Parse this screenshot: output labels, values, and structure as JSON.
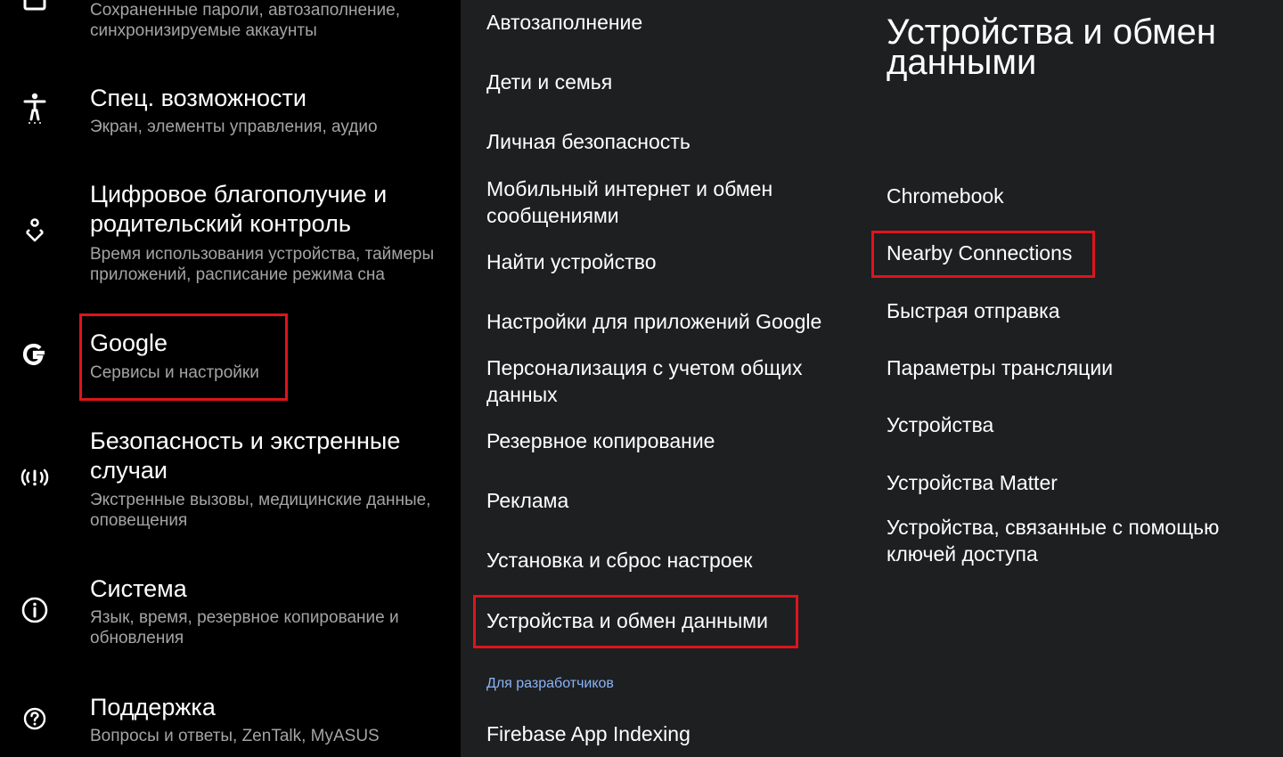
{
  "left_panel": {
    "items": [
      {
        "id": "passwords",
        "title": "",
        "subtitle": "Сохраненные пароли, автозаполнение, синхронизируемые аккаунты",
        "icon": "account-box-icon"
      },
      {
        "id": "accessibility",
        "title": "Спец. возможности",
        "subtitle": "Экран, элементы управления, аудио",
        "icon": "accessibility-icon"
      },
      {
        "id": "digital_wellbeing",
        "title": "Цифровое благополучие и родительский контроль",
        "subtitle": "Время использования устройства, таймеры приложений, расписание режима сна",
        "icon": "wellbeing-icon"
      },
      {
        "id": "google",
        "title": "Google",
        "subtitle": "Сервисы и настройки",
        "icon": "google-icon"
      },
      {
        "id": "safety",
        "title": "Безопасность и экстренные случаи",
        "subtitle": "Экстренные вызовы, медицинские данные, оповещения",
        "icon": "emergency-icon"
      },
      {
        "id": "system",
        "title": "Система",
        "subtitle": "Язык, время, резервное копирование и обновления",
        "icon": "info-icon"
      },
      {
        "id": "support",
        "title": "Поддержка",
        "subtitle": "Вопросы и ответы, ZenTalk, MyASUS",
        "icon": "help-icon"
      }
    ]
  },
  "middle_panel": {
    "items": [
      "Автозаполнение",
      "Дети и семья",
      "Личная безопасность",
      "Мобильный интернет и обмен сообщениями",
      "Найти устройство",
      "Настройки для приложений Google",
      "Персонализация с учетом общих данных",
      "Резервное копирование",
      "Реклама",
      "Установка и сброс настроек",
      "Устройства и обмен данными"
    ],
    "section_header": "Для разработчиков",
    "dev_items": [
      "Firebase App Indexing"
    ]
  },
  "right_panel": {
    "title": "Устройства и обмен данными",
    "items": [
      "Chromebook",
      "Nearby Connections",
      "Быстрая отправка",
      "Параметры трансляции",
      "Устройства",
      "Устройства Matter",
      "Устройства, связанные с помощью ключей доступа"
    ]
  },
  "colors": {
    "left_bg": "#000000",
    "panel_bg": "#1d1f21",
    "highlight": "#e0131c",
    "section_accent": "#8ab4f8",
    "subtitle": "#a4a4a4"
  }
}
